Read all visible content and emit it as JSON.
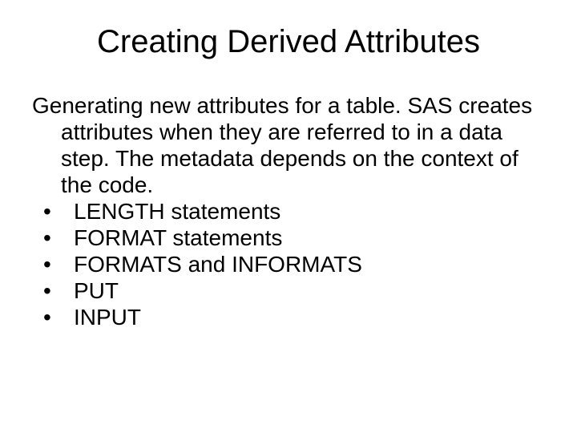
{
  "title": "Creating Derived Attributes",
  "paragraph": "Generating new attributes for a table.  SAS creates attributes when they are referred to in a data step.  The metadata depends on the context of the code.",
  "bullets": [
    "LENGTH statements",
    "FORMAT statements",
    "FORMATS and INFORMATS",
    "PUT",
    "INPUT"
  ]
}
